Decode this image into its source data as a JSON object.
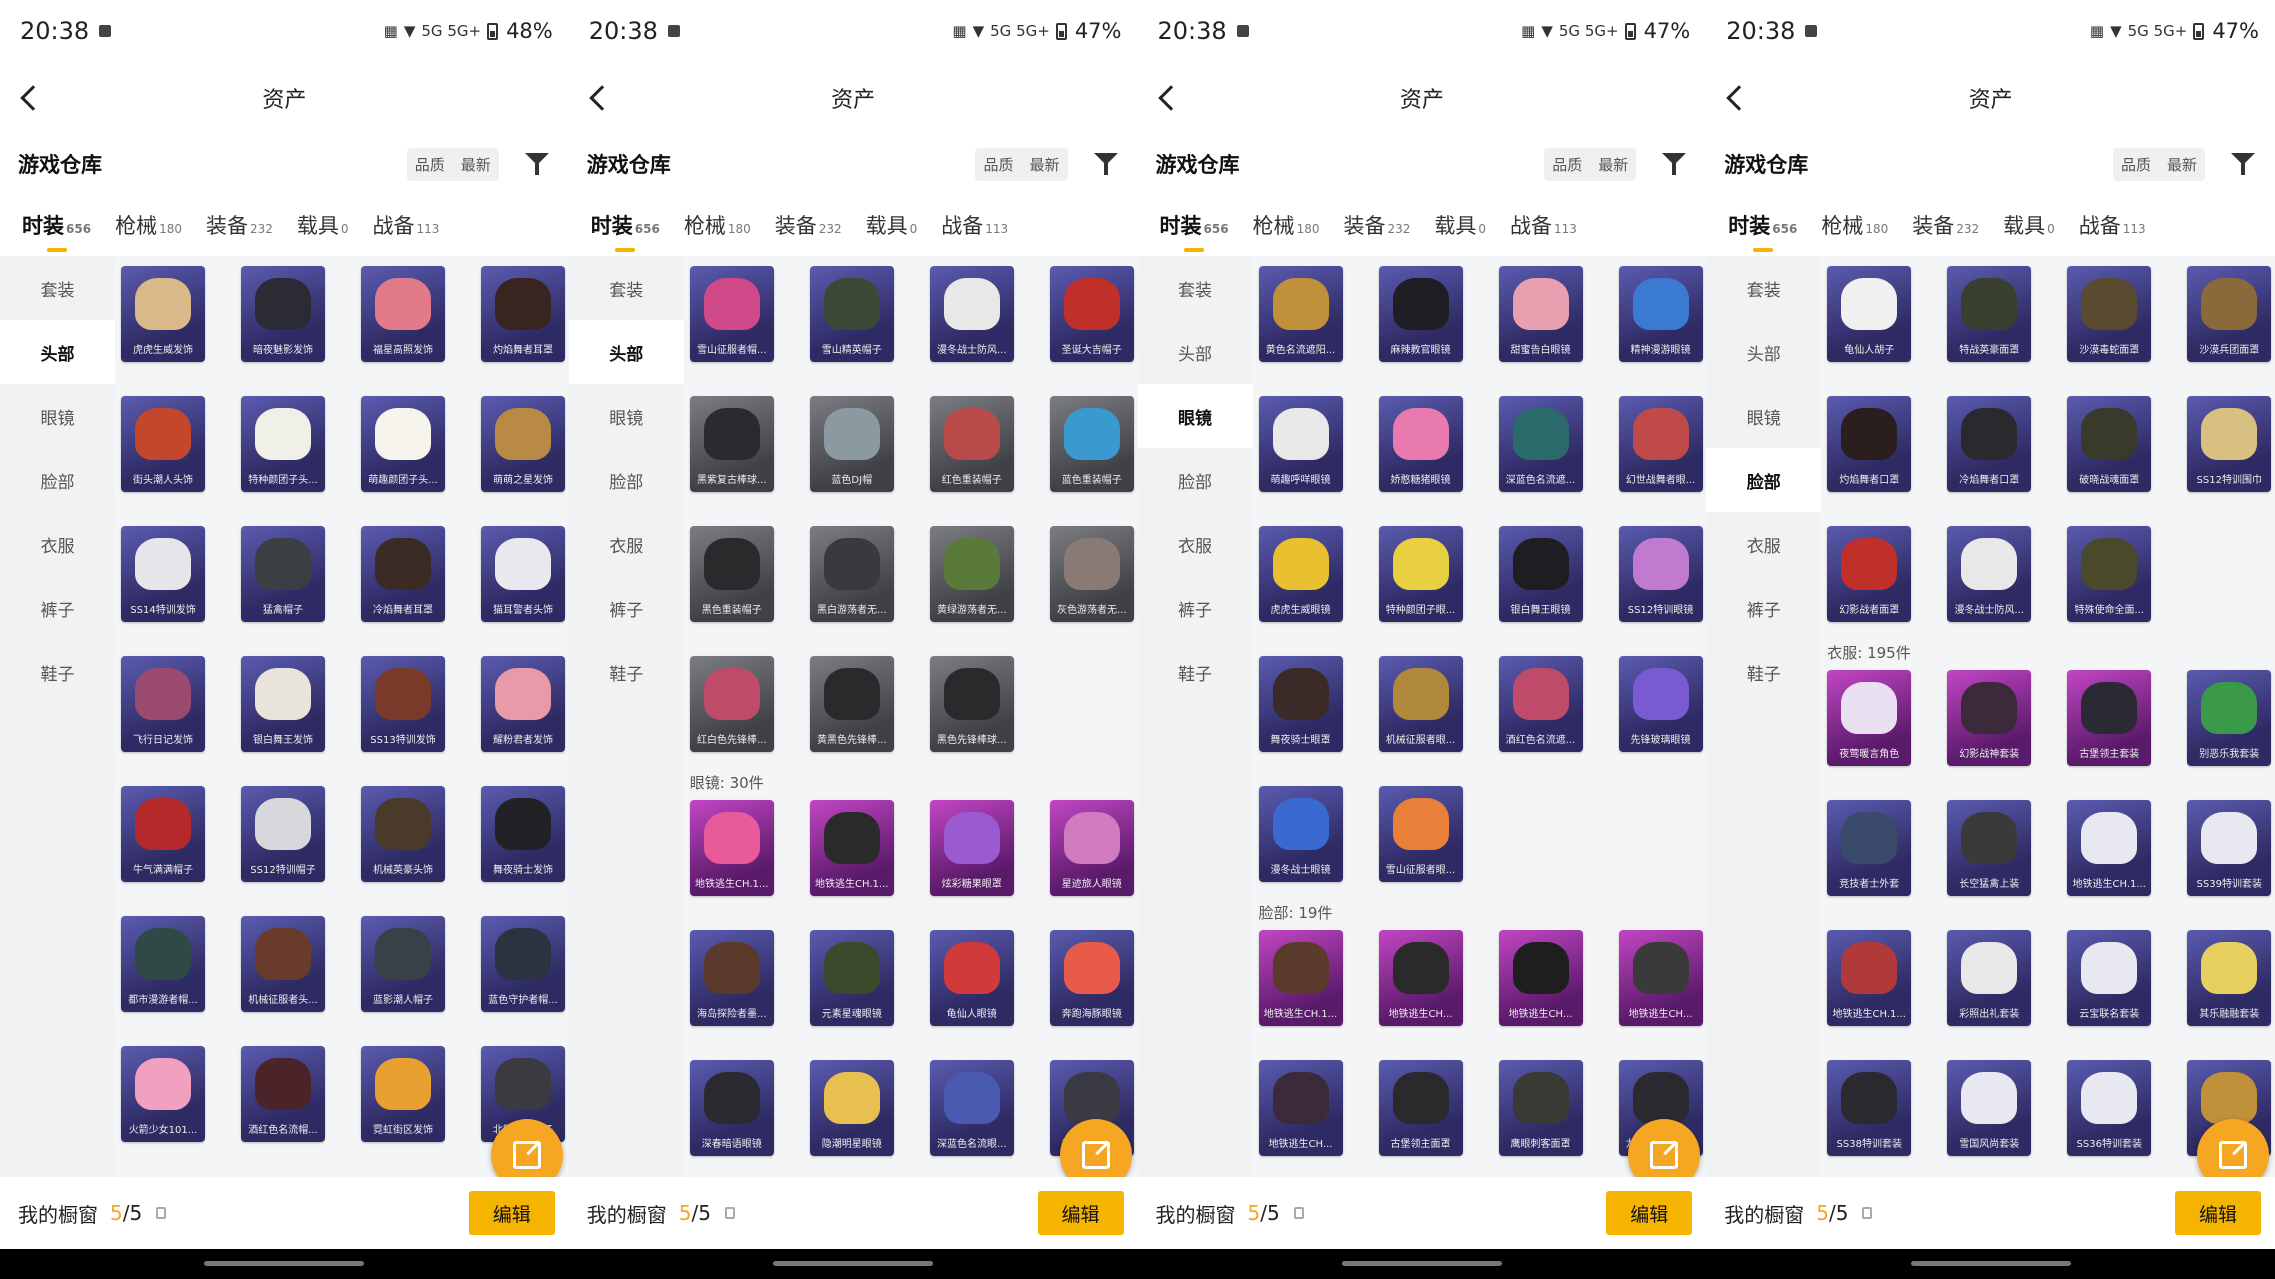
{
  "panels": [
    {
      "time": "20:38",
      "battery": "48%",
      "network": "5G 5G+",
      "title": "资产",
      "warehouse": "游戏仓库",
      "sort": [
        "品质",
        "最新"
      ],
      "tabs": [
        {
          "label": "时装",
          "count": "656"
        },
        {
          "label": "枪械",
          "count": "180"
        },
        {
          "label": "装备",
          "count": "232"
        },
        {
          "label": "载具",
          "count": "0"
        },
        {
          "label": "战备",
          "count": "113"
        }
      ],
      "side": [
        "套装",
        "头部",
        "眼镜",
        "脸部",
        "衣服",
        "裤子",
        "鞋子"
      ],
      "side_active": 1,
      "items": [
        {
          "name": "虎虎生威发饰",
          "color": "blue",
          "art": "#d9b98a"
        },
        {
          "name": "暗夜魅影发饰",
          "color": "blue",
          "art": "#2b2b36"
        },
        {
          "name": "福星高照发饰",
          "color": "blue",
          "art": "#e27a8a"
        },
        {
          "name": "灼焰舞者耳罩",
          "color": "blue",
          "art": "#3a2420"
        },
        {
          "name": "街头潮人头饰",
          "color": "blue",
          "art": "#c4462d"
        },
        {
          "name": "特种颜团子头...",
          "color": "blue",
          "art": "#f0f0e8"
        },
        {
          "name": "萌趣颜团子头...",
          "color": "blue",
          "art": "#f7f4ee"
        },
        {
          "name": "萌萌之星发饰",
          "color": "blue",
          "art": "#b98a45"
        },
        {
          "name": "SS14特训发饰",
          "color": "blue",
          "art": "#e5e5ea"
        },
        {
          "name": "猛禽帽子",
          "color": "blue",
          "art": "#3b3f44"
        },
        {
          "name": "冷焰舞者耳罩",
          "color": "blue",
          "art": "#3a2c24"
        },
        {
          "name": "猫耳警者头饰",
          "color": "blue",
          "art": "#e8e8ee"
        },
        {
          "name": "飞行日记发饰",
          "color": "blue",
          "art": "#9a4a6e"
        },
        {
          "name": "银白舞王发饰",
          "color": "blue",
          "art": "#e8e4dc"
        },
        {
          "name": "SS13特训发饰",
          "color": "blue",
          "art": "#7a3a2a"
        },
        {
          "name": "耀粉君者发饰",
          "color": "blue",
          "art": "#e89aa8"
        },
        {
          "name": "牛气满满帽子",
          "color": "blue",
          "art": "#b42a2a"
        },
        {
          "name": "SS12特训帽子",
          "color": "blue",
          "art": "#d8d8dc"
        },
        {
          "name": "机械英豪头饰",
          "color": "blue",
          "art": "#4a3a2a"
        },
        {
          "name": "舞夜骑士发饰",
          "color": "blue",
          "art": "#222226"
        },
        {
          "name": "都市漫游者帽...",
          "color": "blue",
          "art": "#2f4a46"
        },
        {
          "name": "机械征服者头...",
          "color": "blue",
          "art": "#6a3a2a"
        },
        {
          "name": "蓝影潮人帽子",
          "color": "blue",
          "art": "#3a4048"
        },
        {
          "name": "蓝色守护者帽...",
          "color": "blue",
          "art": "#2a3440"
        },
        {
          "name": "火箭少女101...",
          "color": "blue",
          "art": "#f2a0c0"
        },
        {
          "name": "酒红色名流帽...",
          "color": "blue",
          "art": "#4a2428"
        },
        {
          "name": "霓虹街区发饰",
          "color": "blue",
          "art": "#e8a030"
        },
        {
          "name": "北国狐狸帽子",
          "color": "blue",
          "art": "#3a3a40"
        }
      ],
      "section": null,
      "section_at": 28,
      "items2": [],
      "showcase_label": "我的橱窗",
      "showcase_cur": "5",
      "showcase_total": "/5",
      "edit": "编辑"
    },
    {
      "time": "20:38",
      "battery": "47%",
      "network": "5G 5G+",
      "title": "资产",
      "warehouse": "游戏仓库",
      "sort": [
        "品质",
        "最新"
      ],
      "tabs": [
        {
          "label": "时装",
          "count": "656"
        },
        {
          "label": "枪械",
          "count": "180"
        },
        {
          "label": "装备",
          "count": "232"
        },
        {
          "label": "载具",
          "count": "0"
        },
        {
          "label": "战备",
          "count": "113"
        }
      ],
      "side": [
        "套装",
        "头部",
        "眼镜",
        "脸部",
        "衣服",
        "裤子",
        "鞋子"
      ],
      "side_active": 1,
      "items": [
        {
          "name": "雪山征服者帽...",
          "color": "blue",
          "art": "#d04a8a"
        },
        {
          "name": "雪山精英帽子",
          "color": "blue",
          "art": "#3a4a36"
        },
        {
          "name": "漫冬战士防风...",
          "color": "blue",
          "art": "#e8e8e8"
        },
        {
          "name": "圣诞大吉帽子",
          "color": "blue",
          "art": "#c0302a"
        },
        {
          "name": "黑紫复古棒球...",
          "color": "gray",
          "art": "#2a2a30"
        },
        {
          "name": "蓝色DJ帽",
          "color": "gray",
          "art": "#8a9aa0"
        },
        {
          "name": "红色重装帽子",
          "color": "gray",
          "art": "#b84a4a"
        },
        {
          "name": "蓝色重装帽子",
          "color": "gray",
          "art": "#3a9ad0"
        },
        {
          "name": "黑色重装帽子",
          "color": "gray",
          "art": "#2a2a2c"
        },
        {
          "name": "黑白游荡者无...",
          "color": "gray",
          "art": "#3a3a3e"
        },
        {
          "name": "黄绿游荡者无...",
          "color": "gray",
          "art": "#5a7a3a"
        },
        {
          "name": "灰色游荡者无...",
          "color": "gray",
          "art": "#8a7a76"
        },
        {
          "name": "红白色先锋棒...",
          "color": "gray",
          "art": "#c04a6a"
        },
        {
          "name": "黄黑色先锋棒...",
          "color": "gray",
          "art": "#2a2a2c"
        },
        {
          "name": "黑色先锋棒球...",
          "color": "gray",
          "art": "#2a2a2c"
        }
      ],
      "section": "眼镜: 30件",
      "section_at": 15,
      "items2": [
        {
          "name": "地铁逃生CH.1...",
          "color": "purple",
          "art": "#e85a9a"
        },
        {
          "name": "地铁逃生CH.1...",
          "color": "purple",
          "art": "#2a2a2a"
        },
        {
          "name": "炫彩糖果眼罩",
          "color": "purple",
          "art": "#9a5ad0"
        },
        {
          "name": "星迹旅人眼镜",
          "color": "purple",
          "art": "#d07ac0"
        },
        {
          "name": "海岛探险者墨...",
          "color": "blue",
          "art": "#5a3a2a"
        },
        {
          "name": "元素星魂眼镜",
          "color": "blue",
          "art": "#3a4a2a"
        },
        {
          "name": "龟仙人眼镜",
          "color": "blue",
          "art": "#d03a3a"
        },
        {
          "name": "奔跑海豚眼镜",
          "color": "blue",
          "art": "#e85a4a"
        },
        {
          "name": "深春暗语眼镜",
          "color": "blue",
          "art": "#2a2a30"
        },
        {
          "name": "隐潮明星眼镜",
          "color": "blue",
          "art": "#e8c050"
        },
        {
          "name": "深蓝色名流眼...",
          "color": "blue",
          "art": "#4a5ab0"
        },
        {
          "name": "极地旅宠眼镜",
          "color": "blue",
          "art": "#3a3a44"
        }
      ],
      "showcase_label": "我的橱窗",
      "showcase_cur": "5",
      "showcase_total": "/5",
      "edit": "编辑"
    },
    {
      "time": "20:38",
      "battery": "47%",
      "network": "5G 5G+",
      "title": "资产",
      "warehouse": "游戏仓库",
      "sort": [
        "品质",
        "最新"
      ],
      "tabs": [
        {
          "label": "时装",
          "count": "656"
        },
        {
          "label": "枪械",
          "count": "180"
        },
        {
          "label": "装备",
          "count": "232"
        },
        {
          "label": "载具",
          "count": "0"
        },
        {
          "label": "战备",
          "count": "113"
        }
      ],
      "side": [
        "套装",
        "头部",
        "眼镜",
        "脸部",
        "衣服",
        "裤子",
        "鞋子"
      ],
      "side_active": 2,
      "items": [
        {
          "name": "黄色名流遮阳...",
          "color": "blue",
          "art": "#c0903a"
        },
        {
          "name": "麻辣教官眼镜",
          "color": "blue",
          "art": "#1e1e24"
        },
        {
          "name": "甜蜜告白眼镜",
          "color": "blue",
          "art": "#e8a0b0"
        },
        {
          "name": "精神漫游眼镜",
          "color": "blue",
          "art": "#3a7ad0"
        },
        {
          "name": "萌趣呼咩眼镜",
          "color": "blue",
          "art": "#e8e8e8"
        },
        {
          "name": "娇憨糖猪眼镜",
          "color": "blue",
          "art": "#e87ab0"
        },
        {
          "name": "深蓝色名流遮...",
          "color": "blue",
          "art": "#2a6a6a"
        },
        {
          "name": "幻世战舞者眼...",
          "color": "blue",
          "art": "#c04a4a"
        },
        {
          "name": "虎虎生威眼镜",
          "color": "blue",
          "art": "#e8c030"
        },
        {
          "name": "特种颜团子眼...",
          "color": "blue",
          "art": "#e8d040"
        },
        {
          "name": "银白舞王眼镜",
          "color": "blue",
          "art": "#1e1e22"
        },
        {
          "name": "SS12特训眼镜",
          "color": "blue",
          "art": "#c07ad0"
        },
        {
          "name": "舞夜骑士眼罩",
          "color": "blue",
          "art": "#3a2a28"
        },
        {
          "name": "机械征服者眼...",
          "color": "blue",
          "art": "#b08a3a"
        },
        {
          "name": "酒红色名流遮...",
          "color": "blue",
          "art": "#c04a6a"
        },
        {
          "name": "先锋玻璃眼镜",
          "color": "blue",
          "art": "#7a5ad0"
        },
        {
          "name": "漫冬战士眼镜",
          "color": "blue",
          "art": "#3a6ad0"
        },
        {
          "name": "雪山征服者眼...",
          "color": "blue",
          "art": "#e8803a"
        }
      ],
      "section": "脸部: 19件",
      "section_at": 18,
      "items2": [
        {
          "name": "地铁逃生CH.1...",
          "color": "purple",
          "art": "#5a3a2a"
        },
        {
          "name": "地铁逃生CH...",
          "color": "purple",
          "art": "#2a2a2a"
        },
        {
          "name": "地铁逃生CH...",
          "color": "purple",
          "art": "#1e1e1e"
        },
        {
          "name": "地铁逃生CH...",
          "color": "purple",
          "art": "#3a3a3a"
        },
        {
          "name": "地铁逃生CH...",
          "color": "blue",
          "art": "#3a2a3a"
        },
        {
          "name": "古堡领主面罩",
          "color": "blue",
          "art": "#2a2a2c"
        },
        {
          "name": "鹰眼刺客面罩",
          "color": "blue",
          "art": "#3a3a34"
        },
        {
          "name": "龙魂突击队面...",
          "color": "blue",
          "art": "#2a2a30"
        }
      ],
      "showcase_label": "我的橱窗",
      "showcase_cur": "5",
      "showcase_total": "/5",
      "edit": "编辑"
    },
    {
      "time": "20:38",
      "battery": "47%",
      "network": "5G 5G+",
      "title": "资产",
      "warehouse": "游戏仓库",
      "sort": [
        "品质",
        "最新"
      ],
      "tabs": [
        {
          "label": "时装",
          "count": "656"
        },
        {
          "label": "枪械",
          "count": "180"
        },
        {
          "label": "装备",
          "count": "232"
        },
        {
          "label": "载具",
          "count": "0"
        },
        {
          "label": "战备",
          "count": "113"
        }
      ],
      "side": [
        "套装",
        "头部",
        "眼镜",
        "脸部",
        "衣服",
        "裤子",
        "鞋子"
      ],
      "side_active": 3,
      "items": [
        {
          "name": "龟仙人胡子",
          "color": "blue",
          "art": "#f0f0f0"
        },
        {
          "name": "特战英豪面罩",
          "color": "blue",
          "art": "#3a4030"
        },
        {
          "name": "沙漠毒蛇面罩",
          "color": "blue",
          "art": "#5a4a30"
        },
        {
          "name": "沙漠兵团面罩",
          "color": "blue",
          "art": "#8a6a3a"
        },
        {
          "name": "灼焰舞者口罩",
          "color": "blue",
          "art": "#2a1e1e"
        },
        {
          "name": "冷焰舞者口罩",
          "color": "blue",
          "art": "#2a2a2e"
        },
        {
          "name": "破晓战魂面罩",
          "color": "blue",
          "art": "#3a3a2a"
        },
        {
          "name": "SS12特训围巾",
          "color": "blue",
          "art": "#d8c080"
        },
        {
          "name": "幻影战者面罩",
          "color": "blue",
          "art": "#c0302a"
        },
        {
          "name": "漫冬战士防风...",
          "color": "blue",
          "art": "#e8e8e8"
        },
        {
          "name": "特殊使命全面...",
          "color": "blue",
          "art": "#4a4a2a"
        }
      ],
      "section": "衣服: 195件",
      "section_at": 11,
      "items2": [
        {
          "name": "夜莺暖言角色",
          "color": "purple",
          "art": "#e8e0f0"
        },
        {
          "name": "幻影战神套装",
          "color": "purple",
          "art": "#3a2a3a"
        },
        {
          "name": "古堡领主套装",
          "color": "purple",
          "art": "#2a2a34"
        },
        {
          "name": "别恶乐我套装",
          "color": "blue",
          "art": "#3a9a4a"
        },
        {
          "name": "竞技者士外套",
          "color": "blue",
          "art": "#3a4a6a"
        },
        {
          "name": "长空猛禽上装",
          "color": "blue",
          "art": "#3a3a3a"
        },
        {
          "name": "地铁逃生CH.1...",
          "color": "blue",
          "art": "#e8e8f0"
        },
        {
          "name": "SS39特训套装",
          "color": "blue",
          "art": "#e8e8f0"
        },
        {
          "name": "地铁逃生CH.1...",
          "color": "blue",
          "art": "#b03a3a"
        },
        {
          "name": "彩照出礼套装",
          "color": "blue",
          "art": "#e8e8e8"
        },
        {
          "name": "云宝联名套装",
          "color": "blue",
          "art": "#e8e8f0"
        },
        {
          "name": "其乐融融套装",
          "color": "blue",
          "art": "#e8d060"
        },
        {
          "name": "SS38特训套装",
          "color": "blue",
          "art": "#2a2a30"
        },
        {
          "name": "雪国风尚套装",
          "color": "blue",
          "art": "#e8e8f0"
        },
        {
          "name": "SS36特训套装",
          "color": "blue",
          "art": "#e8e8f0"
        },
        {
          "name": "炫彩珊瑚套装",
          "color": "blue",
          "art": "#c0903a"
        }
      ],
      "showcase_label": "我的橱窗",
      "showcase_cur": "5",
      "showcase_total": "/5",
      "edit": "编辑"
    }
  ],
  "icons": {
    "back": "back-arrow-icon",
    "filter": "filter-icon",
    "share": "share-icon",
    "lock": "lock-icon"
  },
  "colors": {
    "accent": "#f5b400",
    "fab": "#f5a623"
  }
}
